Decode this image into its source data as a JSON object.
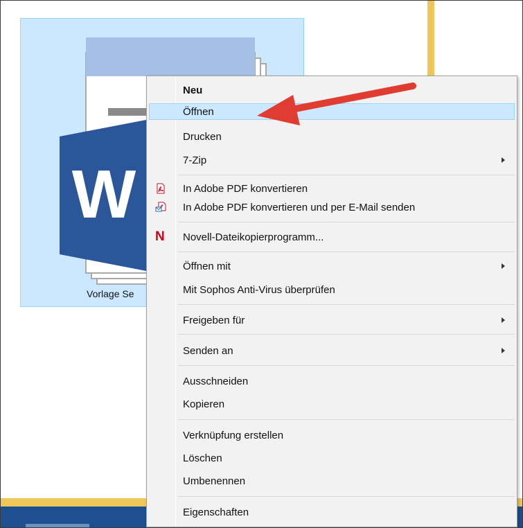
{
  "file": {
    "label": "Vorlage Se"
  },
  "menu": {
    "items": [
      {
        "id": "neu",
        "label": "Neu"
      },
      {
        "id": "oeffnen",
        "label": "Öffnen"
      },
      {
        "id": "drucken",
        "label": "Drucken"
      },
      {
        "id": "7zip",
        "label": "7-Zip"
      },
      {
        "id": "adobe-pdf",
        "label": "In Adobe PDF konvertieren"
      },
      {
        "id": "adobe-pdf-email",
        "label": "In Adobe PDF konvertieren und per E-Mail senden"
      },
      {
        "id": "novell",
        "label": "Novell-Dateikopierprogramm..."
      },
      {
        "id": "oeffnen-mit",
        "label": "Öffnen mit"
      },
      {
        "id": "sophos",
        "label": "Mit Sophos Anti-Virus überprüfen"
      },
      {
        "id": "freigeben",
        "label": "Freigeben für"
      },
      {
        "id": "senden",
        "label": "Senden an"
      },
      {
        "id": "ausschneiden",
        "label": "Ausschneiden"
      },
      {
        "id": "kopieren",
        "label": "Kopieren"
      },
      {
        "id": "verknuepfung",
        "label": "Verknüpfung erstellen"
      },
      {
        "id": "loeschen",
        "label": "Löschen"
      },
      {
        "id": "umbenennen",
        "label": "Umbenennen"
      },
      {
        "id": "eigenschaften",
        "label": "Eigenschaften"
      }
    ]
  },
  "icons": {
    "word": "word-document-icon",
    "pdf": "adobe-pdf-icon",
    "pdf_email": "adobe-pdf-email-icon",
    "novell": "novell-icon",
    "submenu": "chevron-right-icon",
    "annotation": "red-arrow-annotation"
  },
  "colors": {
    "selection": "#cce8ff",
    "selection_border": "#99d1ff",
    "menu_bg": "#f2f2f2",
    "word_blue": "#2b579a",
    "arrow_red": "#e03c31",
    "taskbar": "#1d4f91",
    "window_edge": "#f0c65a"
  }
}
